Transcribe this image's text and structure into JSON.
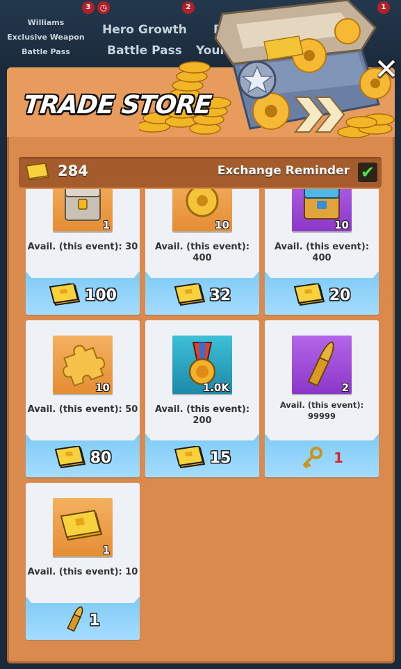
{
  "tabs": [
    {
      "lines": [
        "Williams",
        "Exclusive Weapon",
        "Battle Pass"
      ],
      "badge": "3"
    },
    {
      "lines": [
        "Hero Growth",
        "Battle Pass"
      ],
      "badge": "2"
    },
    {
      "lines": [
        "D",
        "Your"
      ],
      "badge": "1"
    }
  ],
  "header": {
    "title": "TRADE STORE",
    "close_icon": "close-icon"
  },
  "currency": {
    "icon": "gold-ticket-icon",
    "amount": "284",
    "exchange_reminder_label": "Exchange Reminder",
    "reminder_checked": true
  },
  "items": [
    {
      "name": "Chest",
      "icon": "chest-icon",
      "qty": "1",
      "avail": "Avail. (this event): 30",
      "price": "100",
      "price_currency": "gold-ticket"
    },
    {
      "name": "Gears",
      "icon": "gear-icon",
      "qty": "10",
      "avail": "Avail. (this event): 400",
      "price": "32",
      "price_currency": "gold-ticket"
    },
    {
      "name": "Purple Chest",
      "icon": "purple-chest-icon",
      "qty": "10",
      "avail": "Avail. (this event): 400",
      "price": "20",
      "price_currency": "gold-ticket"
    },
    {
      "name": "Puzzle Piece",
      "icon": "puzzle-icon",
      "qty": "10",
      "avail": "Avail. (this event): 50",
      "price": "80",
      "price_currency": "gold-ticket"
    },
    {
      "name": "Medal",
      "icon": "medal-icon",
      "qty": "1.0K",
      "avail": "Avail. (this event): 200",
      "price": "15",
      "price_currency": "gold-ticket"
    },
    {
      "name": "Bullet",
      "icon": "bullet-icon",
      "qty": "2",
      "avail_line1": "Avail. (this event):",
      "avail_line2": "99999",
      "price": "1",
      "price_currency": "key"
    },
    {
      "name": "Gold Ticket",
      "icon": "gold-ticket-icon",
      "qty": "1",
      "avail": "Avail. (this event): 10",
      "price": "1",
      "price_currency": "bullet"
    }
  ],
  "colors": {
    "panel": "#d98a4c",
    "card": "#eef1f5",
    "price_bg": "#8fd2f8",
    "key_price": "#d42828"
  }
}
